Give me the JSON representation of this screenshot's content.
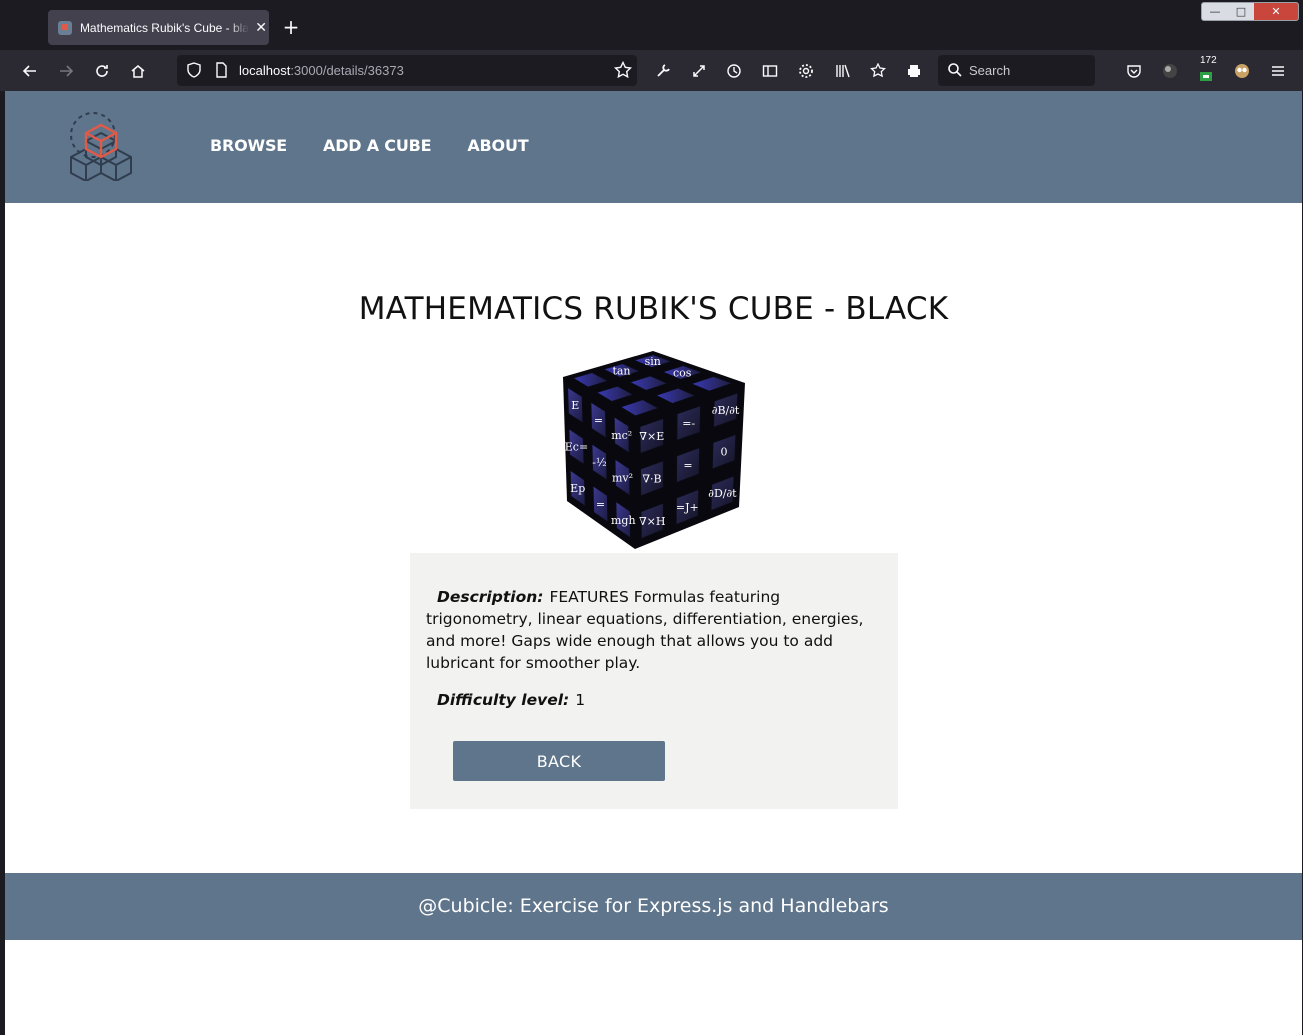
{
  "browser": {
    "tab_title": "Mathematics Rubik's Cube - black",
    "tab_close": "✕",
    "new_tab": "+",
    "url_host": "localhost",
    "url_path": ":3000/details/36373",
    "search_placeholder": "Search",
    "extension_badge": "172",
    "window_controls": {
      "minimize": "—",
      "maximize": "□",
      "close": "✕"
    }
  },
  "site": {
    "nav": {
      "browse": "BROWSE",
      "add": "ADD A CUBE",
      "about": "ABOUT"
    },
    "colors": {
      "header": "#5f758b",
      "accent": "#e05a47"
    }
  },
  "cube": {
    "title": "MATHEMATICS RUBIK'S CUBE - BLACK",
    "description_label": "Description:",
    "description": "FEATURES Formulas featuring trigonometry, linear equations, differentiation, energies, and more! Gaps wide enough that allows you to add lubricant for smoother play.",
    "difficulty_label": "Difficulty level:",
    "difficulty": "1",
    "back_label": "BACK",
    "face_labels": {
      "top": [
        "sin",
        "cos",
        "",
        "tan",
        "",
        "",
        "",
        "",
        ""
      ],
      "left": [
        "E",
        "=",
        "mc²",
        "Ec=",
        "-½",
        "mv²",
        "Ep",
        "=",
        "mgh"
      ],
      "right": [
        "∇×E",
        "=-",
        "∂B/∂t",
        "∇·B",
        "=",
        "0",
        "∇×H",
        "=J+",
        "∂D/∂t"
      ]
    }
  },
  "footer": {
    "text": "@Cubicle: Exercise for Express.js and Handlebars"
  }
}
